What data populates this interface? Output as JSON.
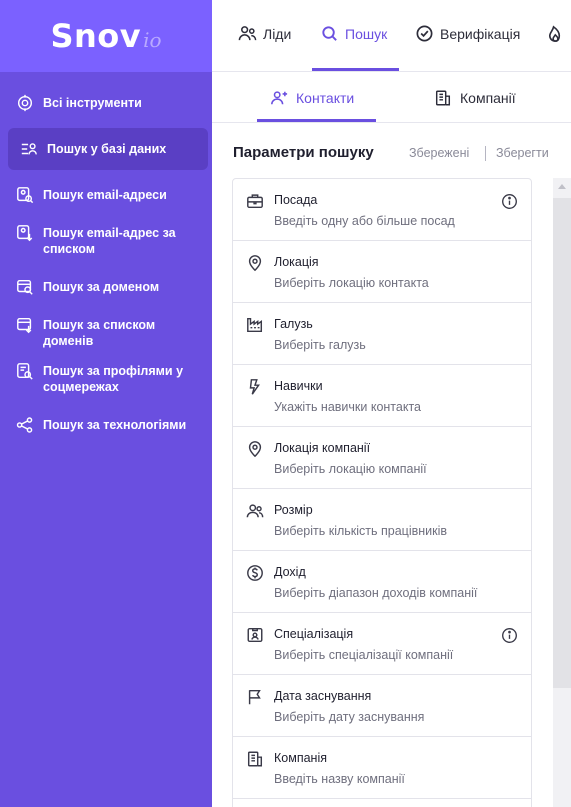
{
  "brand": {
    "logo_main": "Snov",
    "logo_sub": "io"
  },
  "sidebar": {
    "items": [
      {
        "label": "Всі інструменти",
        "icon": "target-icon",
        "active": false
      },
      {
        "label": "Пошук у базі даних",
        "icon": "list-user-icon",
        "active": true
      },
      {
        "label": "Пошук email-адреси",
        "icon": "search-contact-icon",
        "active": false
      },
      {
        "label": "Пошук email-адрес за списком",
        "icon": "list-upload-icon",
        "active": false
      },
      {
        "label": "Пошук за доменом",
        "icon": "domain-search-icon",
        "active": false
      },
      {
        "label": "Пошук за списком доменів",
        "icon": "domain-list-icon",
        "active": false
      },
      {
        "label": "Пошук за профілями у соцмережах",
        "icon": "profile-search-icon",
        "active": false
      },
      {
        "label": "Пошук за технологіями",
        "icon": "share-nodes-icon",
        "active": false
      }
    ]
  },
  "topnav": {
    "items": [
      {
        "label": "Ліди",
        "icon": "users-icon"
      },
      {
        "label": "Пошук",
        "icon": "search-icon",
        "active": true
      },
      {
        "label": "Верифікація",
        "icon": "check-circle-icon"
      },
      {
        "label": "",
        "icon": "flame-icon"
      }
    ]
  },
  "subtabs": {
    "contacts": "Контакти",
    "companies": "Компанії"
  },
  "params": {
    "title": "Параметри пошуку",
    "saved": "Збережені",
    "save": "Зберегти"
  },
  "filters": [
    {
      "name": "Посада",
      "hint": "Введіть одну або більше посад",
      "icon": "briefcase-icon",
      "info": true
    },
    {
      "name": "Локація",
      "hint": "Виберіть локацію контакта",
      "icon": "map-pin-icon",
      "info": false
    },
    {
      "name": "Галузь",
      "hint": "Виберіть галузь",
      "icon": "factory-icon",
      "info": false
    },
    {
      "name": "Навички",
      "hint": "Укажіть навички контакта",
      "icon": "lightning-icon",
      "info": false
    },
    {
      "name": "Локація компанії",
      "hint": "Виберіть локацію компанії",
      "icon": "map-pin-icon",
      "info": false
    },
    {
      "name": "Розмір",
      "hint": "Виберіть кількість працівників",
      "icon": "people-icon",
      "info": false
    },
    {
      "name": "Дохід",
      "hint": "Виберіть діапазон доходів компанії",
      "icon": "dollar-icon",
      "info": false
    },
    {
      "name": "Спеціалізація",
      "hint": "Виберіть спеціалізації компанії",
      "icon": "id-card-icon",
      "info": true
    },
    {
      "name": "Дата заснування",
      "hint": "Виберіть дату заснування",
      "icon": "flag-icon",
      "info": false
    },
    {
      "name": "Компанія",
      "hint": "Введіть назву компанії",
      "icon": "building-icon",
      "info": false
    }
  ]
}
